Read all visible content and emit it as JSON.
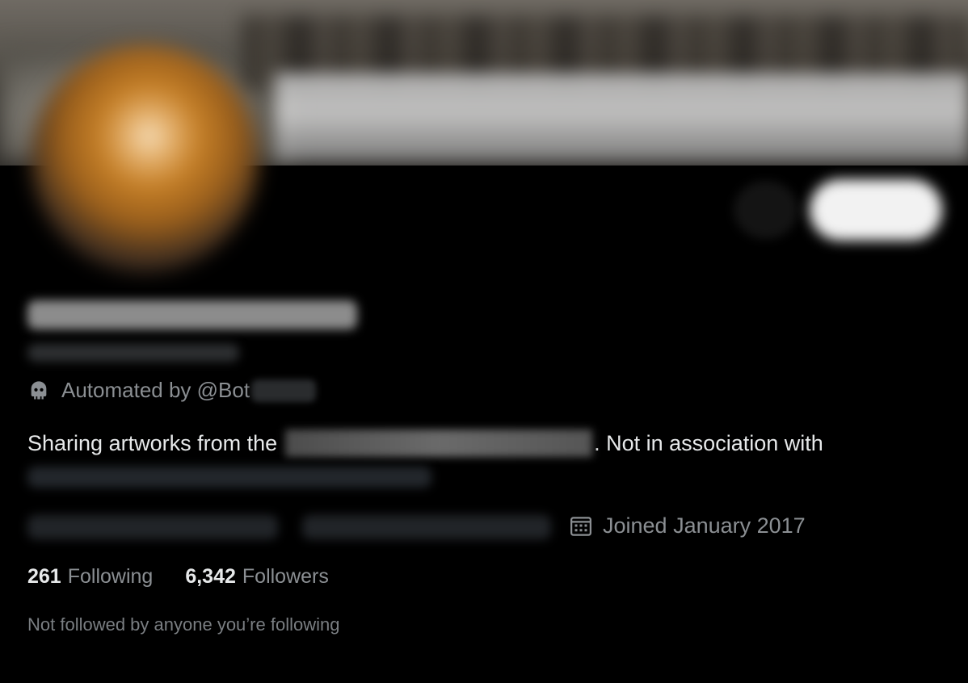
{
  "profile": {
    "automated_prefix": "Automated by @Bot",
    "bio_start": "Sharing artworks from the",
    "bio_end": ". Not in association with",
    "joined": "Joined January 2017",
    "following_count": "261",
    "following_label": "Following",
    "followers_count": "6,342",
    "followers_label": "Followers",
    "not_followed_text": "Not followed by anyone you’re following"
  },
  "icons": {
    "automated": "bot-icon",
    "joined": "calendar-icon"
  },
  "colors": {
    "background": "#000000",
    "primary_text": "#e7e9ea",
    "secondary_text": "#8b8f93"
  }
}
